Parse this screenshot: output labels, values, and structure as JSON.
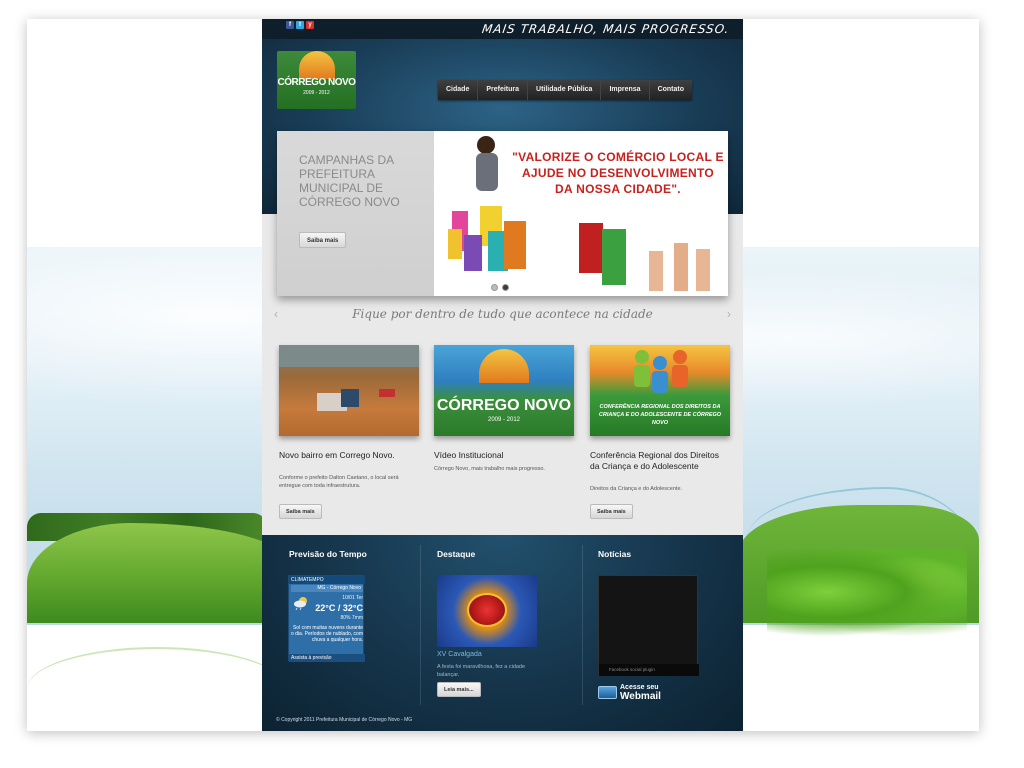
{
  "site": {
    "slogan": "MAIS TRABALHO, MAIS PROGRESSO.",
    "social": [
      "f",
      "t",
      "y"
    ],
    "logo": {
      "line1": "CÓRREGO NOVO",
      "line2": "2009 - 2012"
    },
    "nav": [
      "Cidade",
      "Prefeitura",
      "Utilidade Pública",
      "Imprensa",
      "Contato"
    ]
  },
  "slider": {
    "title": "CAMPANHAS DA PREFEITURA MUNICIPAL DE CÓRREGO NOVO",
    "button": "Saiba mais",
    "campaign_text": "\"VALORIZE O COMÉRCIO LOCAL E AJUDE NO DESENVOLVIMENTO DA NOSSA CIDADE\"."
  },
  "section": {
    "title": "Fique por dentro de tudo que acontece na cidade",
    "prev": "‹",
    "next": "›"
  },
  "cards": [
    {
      "title": "Novo bairro em Corrego Novo.",
      "desc": "Conforme o prefeito Dalton Caetano, o local será entregue com toda infraestrutura.",
      "button": "Saiba mais"
    },
    {
      "title": "Vídeo Institucional",
      "desc": "Córrego Novo, mais trabalho mais progresso.",
      "button": "Saiba mais",
      "img_line1": "CÓRREGO NOVO",
      "img_line2": "2009 - 2012"
    },
    {
      "title": "Conferência Regional dos Direitos da Criança e do Adolescente",
      "desc": "Direitos da Criança e do Adolescente.",
      "button": "Saiba mais",
      "img_text": "CONFERÊNCIA REGIONAL DOS DIREITOS DA CRIANÇA E DO ADOLESCENTE DE CÓRREGO NOVO"
    }
  ],
  "footer": {
    "weather": {
      "title": "Previsão do Tempo",
      "brand": "CLIMATEMPO",
      "city": "MG - Córrego Novo",
      "date": "10/01 Ter",
      "temp": "22°C / 32°C",
      "humidity": "80%    7mm",
      "desc": "Sol com muitas nuvens durante o dia. Períodos de nublado, com chuva a qualquer hora.",
      "link": "Assista à previsão"
    },
    "destaque": {
      "title": "Destaque",
      "caption": "XV Cavalgada",
      "desc": "A festa foi maravilhosa, fez a cidade balançar.",
      "button": "Leia mais..."
    },
    "noticias": {
      "title": "Notícias",
      "fb_text": "Facebook social plugin",
      "webmail_line1": "Acesse seu",
      "webmail_line2": "Webmail"
    },
    "copyright": "© Copyright 2011 Prefeitura Municipal de Córrego Novo - MG"
  }
}
